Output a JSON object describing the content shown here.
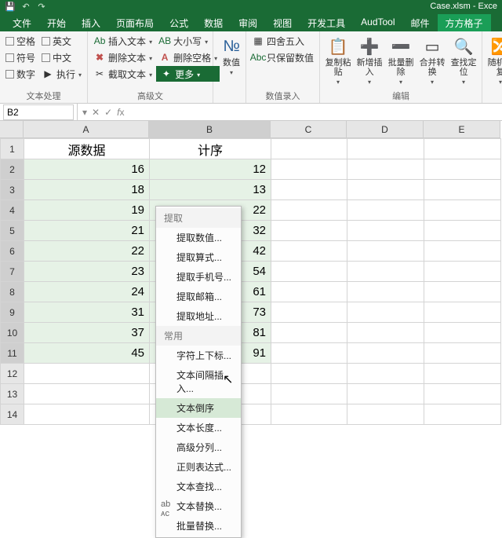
{
  "app_title": "Case.xlsm - Exce",
  "qat": {
    "items": [
      "save",
      "undo",
      "redo"
    ]
  },
  "tabs": [
    "文件",
    "开始",
    "插入",
    "页面布局",
    "公式",
    "数据",
    "审阅",
    "视图",
    "开发工具",
    "AudTool",
    "邮件"
  ],
  "tab_addin": "方方格子",
  "ribbon": {
    "g1": {
      "label": "文本处理",
      "c1": [
        {
          "cb": "空格"
        },
        {
          "cb": "符号"
        },
        {
          "cb": "数字"
        }
      ],
      "c2": [
        {
          "cb": "英文"
        },
        {
          "cb": "中文"
        },
        {
          "lbl": "执行",
          "icon": "▶",
          "dd": true
        }
      ]
    },
    "g2": {
      "label": "高级文",
      "rows": [
        {
          "icon_text": "Ab",
          "lbl": "插入文本",
          "dd": true
        },
        {
          "icon": "✖",
          "cls": "ic-x",
          "lbl": "删除文本",
          "dd": true
        },
        {
          "icon": "✂",
          "lbl": "截取文本",
          "dd": true
        }
      ],
      "rows2": [
        {
          "icon_text": "AB",
          "lbl": "大小写",
          "dd": true
        },
        {
          "icon_text": "A",
          "cls": "ic-A",
          "lbl": "删除空格",
          "dd": true
        },
        {
          "lbl": "更多",
          "dd": true,
          "highlight": true
        }
      ]
    },
    "g3": {
      "big": "数值",
      "dd": true,
      "icon": "🔢"
    },
    "g4": {
      "label": "数值录入",
      "rows": [
        {
          "icon": "▦",
          "lbl": "四舍五入"
        },
        {
          "icon_text": "Abc",
          "lbl": "只保留数值"
        },
        {
          "lbl": "",
          "spacer": true
        }
      ]
    },
    "g5": {
      "label": "编辑",
      "bigs": [
        {
          "cap": "复制粘\n贴",
          "dd": true,
          "ico": "📋"
        },
        {
          "cap": "新增插\n入",
          "dd": true,
          "ico": "➕"
        },
        {
          "cap": "批量删\n除",
          "dd": true,
          "ico": "➖"
        },
        {
          "cap": "合并转\n换",
          "dd": true,
          "ico": "▭"
        },
        {
          "cap": "查找定\n位",
          "dd": true,
          "ico": "🔍"
        }
      ]
    },
    "g6": {
      "big": "随机重\n复",
      "dd": true,
      "ico": "🔀"
    }
  },
  "namebox": "B2",
  "menu": {
    "section1": "提取",
    "items1": [
      "提取数值...",
      "提取算式...",
      "提取手机号...",
      "提取邮箱...",
      "提取地址..."
    ],
    "section2": "常用",
    "items2": [
      {
        "l": "字符上下标..."
      },
      {
        "l": "文本间隔插入..."
      },
      {
        "l": "文本倒序",
        "hl": true
      },
      {
        "l": "文本长度..."
      },
      {
        "l": "高级分列..."
      },
      {
        "l": "正则表达式..."
      },
      {
        "l": "文本查找..."
      },
      {
        "l": "文本替换...",
        "ico": "ab\nᴀc"
      },
      {
        "l": "批量替换..."
      }
    ]
  },
  "grid": {
    "cols": [
      "A",
      "B",
      "C",
      "D",
      "E"
    ],
    "header_row": {
      "A": "源数据",
      "B": "计序"
    },
    "rows": [
      {
        "A": "16",
        "B": "12"
      },
      {
        "A": "18",
        "B": "13"
      },
      {
        "A": "19",
        "B": "22"
      },
      {
        "A": "21",
        "B": "32"
      },
      {
        "A": "22",
        "B": "42"
      },
      {
        "A": "23",
        "B": "54"
      },
      {
        "A": "24",
        "B": "61"
      },
      {
        "A": "31",
        "B": "73"
      },
      {
        "A": "37",
        "B": "81"
      },
      {
        "A": "45",
        "B": "91"
      }
    ],
    "empty_rows": 3,
    "selected_col": "B",
    "selected_row_start": 2,
    "selected_row_end": 11
  }
}
